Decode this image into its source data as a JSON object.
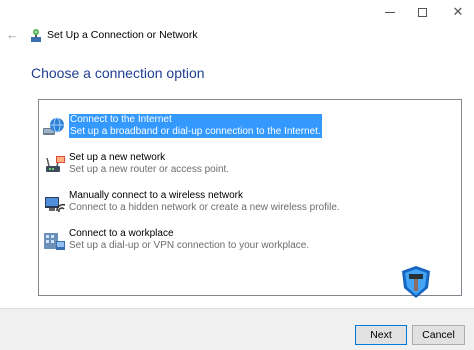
{
  "window": {
    "title": "Set Up a Connection or Network"
  },
  "heading": "Choose a connection option",
  "options": [
    {
      "title": "Connect to the Internet",
      "description": "Set up a broadband or dial-up connection to the Internet.",
      "icon": "globe-network-icon",
      "selected": true
    },
    {
      "title": "Set up a new network",
      "description": "Set up a new router or access point.",
      "icon": "router-icon",
      "selected": false
    },
    {
      "title": "Manually connect to a wireless network",
      "description": "Connect to a hidden network or create a new wireless profile.",
      "icon": "wireless-computer-icon",
      "selected": false
    },
    {
      "title": "Connect to a workplace",
      "description": "Set up a dial-up or VPN connection to your workplace.",
      "icon": "workplace-icon",
      "selected": false
    }
  ],
  "buttons": {
    "next": "Next",
    "cancel": "Cancel"
  },
  "colors": {
    "heading": "#1f3f8f",
    "selection": "#3399ff",
    "footer": "#f0f0f0"
  }
}
